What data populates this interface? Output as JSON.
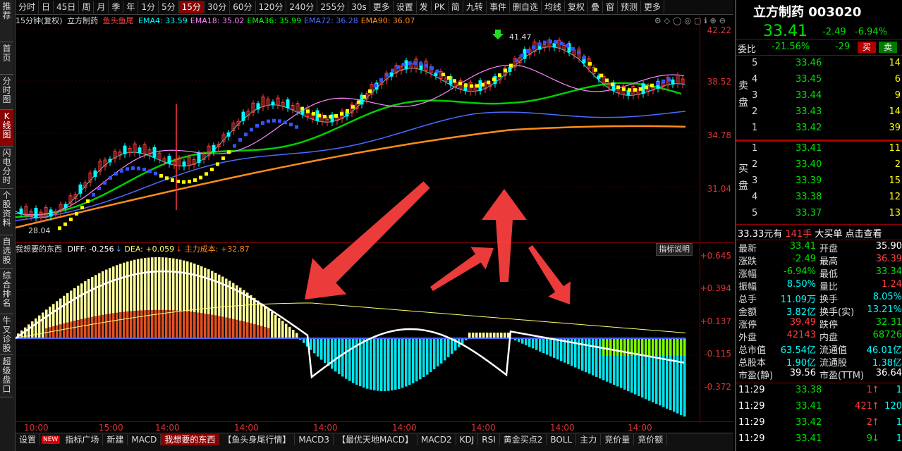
{
  "sidebar": {
    "items": [
      "推荐",
      "首页",
      "分时图",
      "K线图",
      "闪电分时",
      "个股资料",
      "自选股",
      "综合排名",
      "牛叉诊股",
      "超级盘口"
    ],
    "active_index": 3
  },
  "toolbar": {
    "items": [
      "分时",
      "日",
      "45日",
      "周",
      "月",
      "季",
      "年",
      "1分",
      "5分",
      "15分",
      "30分",
      "60分",
      "120分",
      "240分",
      "255分",
      "30s",
      "更多",
      "设置",
      "发",
      "PK",
      "简",
      "九转",
      "事件",
      "删自选",
      "均线",
      "复权",
      "叠",
      "窗",
      "预测",
      "更多"
    ],
    "active": "15分"
  },
  "info": {
    "period": "15分钟(复权)",
    "name": "立方制药",
    "indicator": "鱼头鱼尾",
    "ema": [
      {
        "label": "EMA4: 33.59",
        "color": "#00ffff"
      },
      {
        "label": "EMA18: 35.02",
        "color": "#ff88ff"
      },
      {
        "label": "EMA36: 35.99",
        "color": "#00ff00"
      },
      {
        "label": "EMA72: 36.28",
        "color": "#4a6cff"
      },
      {
        "label": "EMA90: 36.07",
        "color": "#ff8c1a"
      }
    ]
  },
  "main_axis": {
    "ticks": [
      "42.22",
      "38.52",
      "34.78",
      "31.04"
    ],
    "high_mark": "41.47",
    "low_mark": "28.04"
  },
  "sub_header": {
    "name": "我想要的东西",
    "diff": "DIFF: -0.256",
    "dea": "DEA: +0.059",
    "cost": "主力成本: +32.87",
    "help": "指标说明"
  },
  "sub_axis": {
    "ticks": [
      "+0.645",
      "+0.394",
      "+0.137",
      "-0.115",
      "-0.372"
    ]
  },
  "time_axis": [
    "10:00",
    "15:00",
    "14:00",
    "14:00",
    "14:00",
    "14:00",
    "14:00",
    "14:00",
    "14:00"
  ],
  "tabs": {
    "items": [
      "设置",
      "NEW",
      "指标广场",
      "新建",
      "MACD",
      "我想要的东西",
      "【鱼头身尾行情】",
      "MACD3",
      "【最优天地MACD】",
      "MACD2",
      "KDJ",
      "RSI",
      "黄金买点2",
      "BOLL",
      "主力",
      "竞价量",
      "竞价额"
    ],
    "active": "我想要的东西"
  },
  "quote": {
    "title": "立方制药 003020",
    "price": "33.41",
    "change": "-2.49",
    "pct": "-6.94%",
    "weibi_label": "委比",
    "weibi": "-21.56%",
    "weicha": "-29",
    "buy_btn": "买",
    "sell_btn": "卖",
    "sell_label": "卖盘",
    "buy_label": "买盘",
    "sells": [
      {
        "lvl": "5",
        "price": "33.46",
        "vol": "14"
      },
      {
        "lvl": "4",
        "price": "33.45",
        "vol": "6"
      },
      {
        "lvl": "3",
        "price": "33.44",
        "vol": "9"
      },
      {
        "lvl": "2",
        "price": "33.43",
        "vol": "14"
      },
      {
        "lvl": "1",
        "price": "33.42",
        "vol": "39"
      }
    ],
    "buys": [
      {
        "lvl": "1",
        "price": "33.41",
        "vol": "11"
      },
      {
        "lvl": "2",
        "price": "33.40",
        "vol": "2"
      },
      {
        "lvl": "3",
        "price": "33.39",
        "vol": "15"
      },
      {
        "lvl": "4",
        "price": "33.38",
        "vol": "12"
      },
      {
        "lvl": "5",
        "price": "33.37",
        "vol": "13"
      }
    ],
    "big_order": {
      "price": "33.33元有",
      "qty": "141手",
      "text": "大买单",
      "link": "点击查看"
    },
    "stats": [
      {
        "l1": "最新",
        "v1": "33.41",
        "c1": "green",
        "l2": "开盘",
        "v2": "35.90",
        "c2": "white"
      },
      {
        "l1": "涨跌",
        "v1": "-2.49",
        "c1": "green",
        "l2": "最高",
        "v2": "36.39",
        "c2": "red"
      },
      {
        "l1": "涨幅",
        "v1": "-6.94%",
        "c1": "green",
        "l2": "最低",
        "v2": "33.34",
        "c2": "green"
      },
      {
        "l1": "振幅",
        "v1": "8.50%",
        "c1": "cyan",
        "l2": "量比",
        "v2": "1.24",
        "c2": "red"
      },
      {
        "l1": "总手",
        "v1": "11.09万",
        "c1": "cyan",
        "l2": "换手",
        "v2": "8.05%",
        "c2": "cyan"
      },
      {
        "l1": "金额",
        "v1": "3.82亿",
        "c1": "cyan",
        "l2": "换手(实)",
        "v2": "13.21%",
        "c2": "cyan"
      },
      {
        "l1": "涨停",
        "v1": "39.49",
        "c1": "red",
        "l2": "跌停",
        "v2": "32.31",
        "c2": "green"
      },
      {
        "l1": "外盘",
        "v1": "42143",
        "c1": "red",
        "l2": "内盘",
        "v2": "68726",
        "c2": "green"
      },
      {
        "l1": "总市值",
        "v1": "63.54亿",
        "c1": "cyan",
        "l2": "流通值",
        "v2": "46.01亿",
        "c2": "cyan"
      },
      {
        "l1": "总股本",
        "v1": "1.90亿",
        "c1": "cyan",
        "l2": "流通股",
        "v2": "1.38亿",
        "c2": "cyan"
      },
      {
        "l1": "市盈(静)",
        "v1": "39.56",
        "c1": "white",
        "l2": "市盈(TTM)",
        "v2": "36.64",
        "c2": "white"
      }
    ],
    "ticks": [
      {
        "time": "11:29",
        "price": "33.38",
        "vol": "1",
        "dir": "up",
        "num": "1"
      },
      {
        "time": "11:29",
        "price": "33.41",
        "vol": "421",
        "dir": "up",
        "num": "120"
      },
      {
        "time": "11:29",
        "price": "33.42",
        "vol": "2",
        "dir": "up",
        "num": "1"
      },
      {
        "time": "11:29",
        "price": "33.41",
        "vol": "9",
        "dir": "down",
        "num": "1"
      }
    ]
  }
}
